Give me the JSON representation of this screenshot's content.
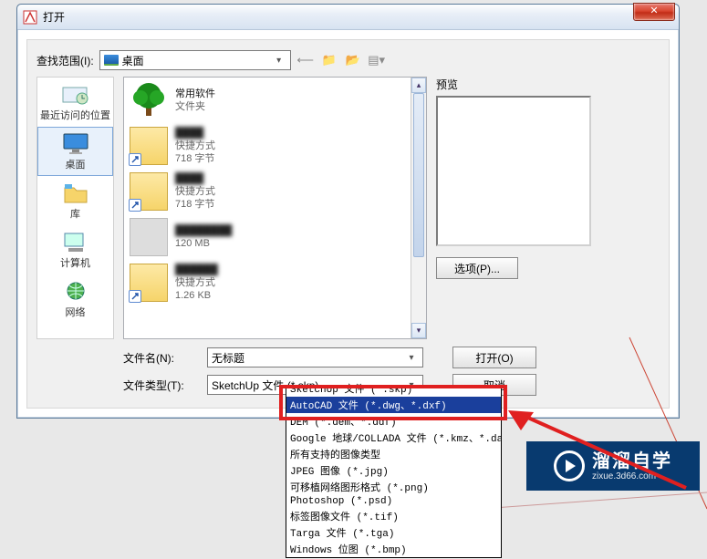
{
  "window": {
    "title": "打开"
  },
  "lookin": {
    "label": "查找范围(I):",
    "value": "桌面"
  },
  "places": {
    "recent": "最近访问的位置",
    "desktop": "桌面",
    "libraries": "库",
    "computer": "计算机",
    "network": "网络"
  },
  "files": [
    {
      "name": "常用软件",
      "sub": "文件夹",
      "kind": "folder-tree"
    },
    {
      "name": "████",
      "sub1": "快捷方式",
      "sub2": "718 字节",
      "kind": "shortcut"
    },
    {
      "name": "████",
      "sub1": "快捷方式",
      "sub2": "718 字节",
      "kind": "shortcut"
    },
    {
      "name": "████████",
      "sub1": "",
      "sub2": "120 MB",
      "kind": "file"
    },
    {
      "name": "██████",
      "sub1": "快捷方式",
      "sub2": "1.26 KB",
      "kind": "shortcut"
    }
  ],
  "filename": {
    "label": "文件名(N):",
    "value": "无标题"
  },
  "filetype": {
    "label": "文件类型(T):",
    "value": "SketchUp 文件 (*.skp)"
  },
  "dropdown": [
    "SketchUp 文件 (*.skp)",
    "AutoCAD 文件 (*.dwg、*.dxf)",
    "DEM (*.dem、*.ddf)",
    "Google 地球/COLLADA 文件 (*.kmz、*.dae)",
    "所有支持的图像类型",
    "JPEG 图像 (*.jpg)",
    "可移植网络图形格式 (*.png)",
    "Photoshop (*.psd)",
    "标签图像文件 (*.tif)",
    "Targa 文件 (*.tga)",
    "Windows 位图 (*.bmp)"
  ],
  "dropdown_selected": 1,
  "buttons": {
    "open": "打开(O)",
    "cancel": "取消",
    "options": "选项(P)..."
  },
  "preview_label": "预览",
  "watermark": {
    "brand": "溜溜自学",
    "url": "zixue.3d66.com"
  }
}
